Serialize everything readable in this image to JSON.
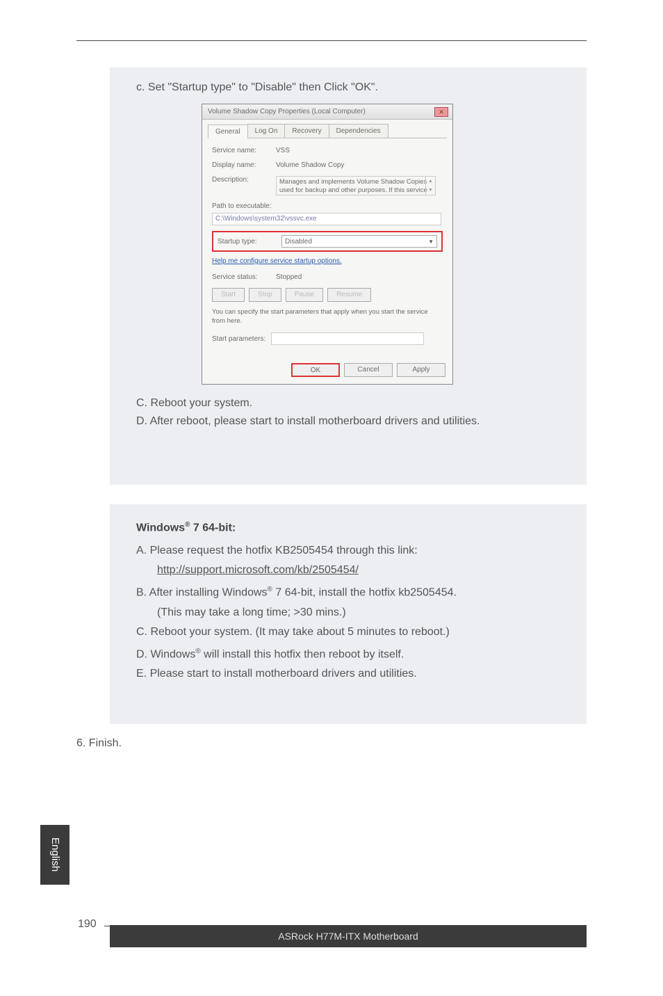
{
  "step_c_label": "c. Set \"Startup type\" to \"Disable\" then Click \"OK\".",
  "dialog": {
    "title": "Volume Shadow Copy Properties (Local Computer)",
    "close_glyph": "✕",
    "tabs": [
      "General",
      "Log On",
      "Recovery",
      "Dependencies"
    ],
    "service_name_label": "Service name:",
    "service_name": "VSS",
    "display_name_label": "Display name:",
    "display_name": "Volume Shadow Copy",
    "description_label": "Description:",
    "description": "Manages and implements Volume Shadow Copies used for backup and other purposes. If this service",
    "path_label": "Path to executable:",
    "path": "C:\\Windows\\system32\\vssvc.exe",
    "startup_label": "Startup type:",
    "startup_value": "Disabled",
    "help_link": "Help me configure service startup options.",
    "service_status_label": "Service status:",
    "service_status": "Stopped",
    "btn_start": "Start",
    "btn_stop": "Stop",
    "btn_pause": "Pause",
    "btn_resume": "Resume",
    "note": "You can specify the start parameters that apply when you start the service from here.",
    "start_params_label": "Start parameters:",
    "btn_ok": "OK",
    "btn_cancel": "Cancel",
    "btn_apply": "Apply"
  },
  "after_c": "C. Reboot your system.",
  "after_d": "D. After reboot, please start to install motherboard drivers and utilities.",
  "win7_heading_pre": "Windows",
  "win7_heading_sup": "®",
  "win7_heading_post": " 7 64-bit:",
  "win7_steps": {
    "a1": "A. Please request the hotfix KB2505454 through this link:",
    "a2": "http://support.microsoft.com/kb/2505454/",
    "b1_pre": "B. After installing Windows",
    "b1_sup": "®",
    "b1_post": " 7 64-bit, install the hotfix kb2505454.",
    "b2": "(This may take a long time; >30 mins.)",
    "c": "C. Reboot your system. (It may take about 5 minutes to reboot.)",
    "d_pre": "D. Windows",
    "d_sup": "®",
    "d_post": " will install this hotfix then reboot by itself.",
    "e": "E. Please start to install motherboard drivers and utilities."
  },
  "step6": "6. Finish.",
  "sidetab": "English",
  "page_num": "190",
  "footer": "ASRock  H77M-ITX  Motherboard"
}
